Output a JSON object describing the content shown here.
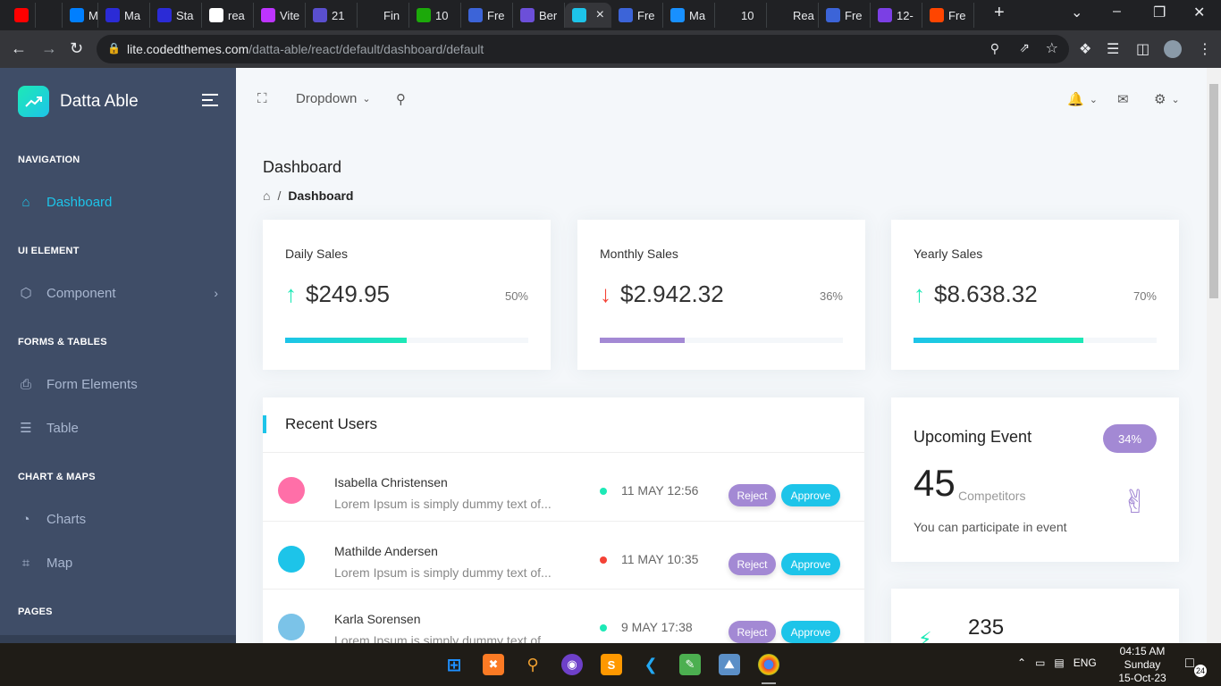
{
  "browser": {
    "tabs": [
      {
        "title": "",
        "icon": "youtube-icon",
        "color": "#ff0000"
      },
      {
        "title": "",
        "icon": "speaker-icon",
        "color": "#202124"
      },
      {
        "title": "Mir",
        "icon": "mui-icon",
        "color": "#007fff"
      },
      {
        "title": "Ma",
        "icon": "bootstrap-icon",
        "color": "#2b2bd6"
      },
      {
        "title": "Sta",
        "icon": "bootstrap-icon",
        "color": "#2b2bd6"
      },
      {
        "title": "rea",
        "icon": "google-icon",
        "color": "#ffffff"
      },
      {
        "title": "Vite",
        "icon": "vite-icon",
        "color": "#bd34fe"
      },
      {
        "title": "21",
        "icon": "react-icon",
        "color": "#5a4fcf"
      },
      {
        "title": "Fin",
        "icon": "triangle-icon",
        "color": "#202124"
      },
      {
        "title": "10",
        "icon": "timer-icon",
        "color": "#1ca90a"
      },
      {
        "title": "Fre",
        "icon": "codedthemes-icon",
        "color": "#3c64d8"
      },
      {
        "title": "Ber",
        "icon": "astro-icon",
        "color": "#6c4fd9"
      },
      {
        "title": "",
        "icon": "datta-icon",
        "color": "#1dc4e9"
      },
      {
        "title": "Fre",
        "icon": "codedthemes-icon",
        "color": "#3c64d8"
      },
      {
        "title": "Ma",
        "icon": "mantis-icon",
        "color": "#1890ff"
      },
      {
        "title": "10",
        "icon": "hashnode-icon",
        "color": "#202124"
      },
      {
        "title": "Rea",
        "icon": "medium-icon",
        "color": "#202124"
      },
      {
        "title": "Fre",
        "icon": "codedthemes-icon",
        "color": "#3c64d8"
      },
      {
        "title": "12-",
        "icon": "wp-icon",
        "color": "#7b3fe4"
      },
      {
        "title": "Fre",
        "icon": "reddit-icon",
        "color": "#ff4500"
      }
    ],
    "url_host": "lite.codedthemes.com",
    "url_path": "/datta-able/react/default/dashboard/default"
  },
  "sidebar": {
    "brand": "Datta Able",
    "sections": [
      {
        "caption": "NAVIGATION",
        "items": [
          {
            "label": "Dashboard",
            "icon": "home-icon"
          }
        ]
      },
      {
        "caption": "UI ELEMENT",
        "items": [
          {
            "label": "Component",
            "icon": "box-icon"
          }
        ]
      },
      {
        "caption": "FORMS & TABLES",
        "items": [
          {
            "label": "Form Elements",
            "icon": "file-text-icon"
          },
          {
            "label": "Table",
            "icon": "server-icon"
          }
        ]
      },
      {
        "caption": "CHART & MAPS",
        "items": [
          {
            "label": "Charts",
            "icon": "pie-chart-icon"
          },
          {
            "label": "Map",
            "icon": "map-icon"
          }
        ]
      },
      {
        "caption": "PAGES",
        "items": []
      }
    ]
  },
  "topbar": {
    "dropdown": "Dropdown"
  },
  "page": {
    "title": "Dashboard",
    "breadcrumb": "Dashboard"
  },
  "stats": [
    {
      "label": "Daily Sales",
      "amount": "$249.95",
      "pct": "50%",
      "fill": 0.5,
      "trend": "up",
      "color": "#1de9b6"
    },
    {
      "label": "Monthly Sales",
      "amount": "$2.942.32",
      "pct": "36%",
      "fill": 0.35,
      "trend": "down",
      "color": "#a389d4"
    },
    {
      "label": "Yearly Sales",
      "amount": "$8.638.32",
      "pct": "70%",
      "fill": 0.7,
      "trend": "up",
      "color": "#1dc4e9"
    }
  ],
  "recent_users": {
    "title": "Recent Users",
    "reject": "Reject",
    "approve": "Approve",
    "rows": [
      {
        "name": "Isabella Christensen",
        "desc": "Lorem Ipsum is simply dummy text of...",
        "date": "11 MAY 12:56",
        "status": "#1de9b6"
      },
      {
        "name": "Mathilde Andersen",
        "desc": "Lorem Ipsum is simply dummy text of...",
        "date": "11 MAY 10:35",
        "status": "#f44236"
      },
      {
        "name": "Karla Sorensen",
        "desc": "Lorem Ipsum is simply dummy text of...",
        "date": "9 MAY 17:38",
        "status": "#1de9b6"
      }
    ]
  },
  "event": {
    "title": "Upcoming Event",
    "badge": "34%",
    "count": "45",
    "unit": "Competitors",
    "desc": "You can participate in event"
  },
  "card2": {
    "count": "235"
  },
  "taskbar": {
    "lang": "ENG",
    "time": "04:15 AM",
    "day": "Sunday",
    "date": "15-Oct-23",
    "notifications": "24"
  }
}
